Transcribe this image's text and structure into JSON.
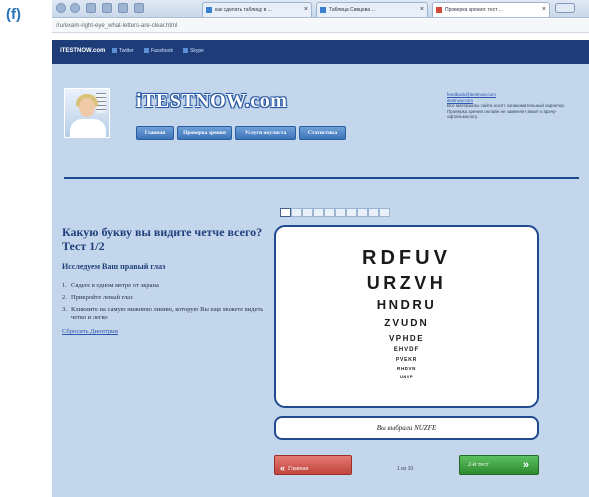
{
  "figure_label": "(f)",
  "browser": {
    "tabs": [
      {
        "label": "как сделать таблицу в ...",
        "active": false
      },
      {
        "label": "Таблица Сивцева ...",
        "active": false
      },
      {
        "label": "Проверка зрения: тест ...",
        "active": true
      }
    ],
    "address": "/ru/exam-right-eye_what-letters-are-clear.html"
  },
  "topbar": {
    "site": "iTESTNOW.com",
    "social": [
      "Twitter",
      "Facebook",
      "Skype"
    ]
  },
  "header": {
    "logo": "iTESTNOW.com",
    "menu": [
      "Главная",
      "Проверка зрения",
      "Услуги окулиста",
      "Статистика"
    ],
    "info_link1": "feedback@itestnow.com",
    "info_link2": "itestnow.com",
    "info_text": "Все материалы сайта носят ознакомительный характер. Проверка зрения онлайн не заменяет визит к врачу-офтальмологу."
  },
  "question": {
    "title": "Какую букву вы видите четче всего? Тест 1/2",
    "eye": "Исследуем Ваш правый глаз",
    "steps": [
      {
        "n": "1.",
        "text": "Сядьте в одном метре от экрана"
      },
      {
        "n": "2.",
        "text": "Прикройте левый глаз"
      },
      {
        "n": "3.",
        "text": "Кликните на самую нижнюю линию, которую Вы еще можете видеть четко и легко"
      }
    ],
    "reset": "Сбросить Диоптрии"
  },
  "progress": {
    "total": 10,
    "current": 1
  },
  "eye_chart": {
    "rows": [
      "RDFUV",
      "URZVH",
      "HNDRU",
      "ZVUDN",
      "VPHDE",
      "EHVDF",
      "PVEKR",
      "RHDVN",
      "UNVP"
    ]
  },
  "answer": "Вы выбрали NUZFE",
  "nav": {
    "home": "Главная",
    "home_icon": "double-chevron-left",
    "page": "1 из 10",
    "next": "2-й тест",
    "next_icon": "double-chevron-right"
  },
  "colors": {
    "page_bg": "#c4d6ec",
    "accent": "#1f4a8f",
    "home_button": "#d0574f",
    "next_button": "#3fa343"
  }
}
